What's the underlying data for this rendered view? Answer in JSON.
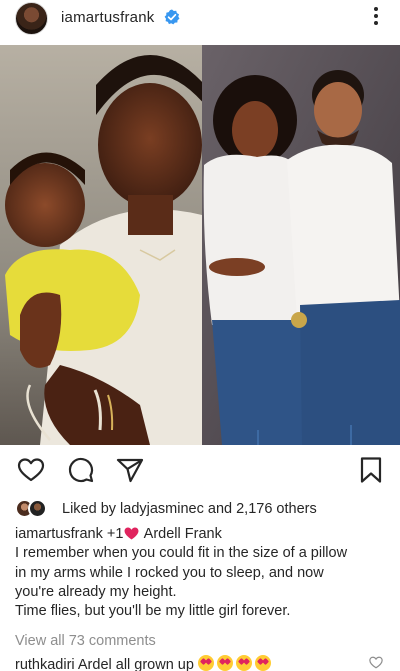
{
  "header": {
    "username": "iamartusfrank",
    "verified": true,
    "avatar_icon": "profile-avatar",
    "more_icon": "more-vertical-icon"
  },
  "post": {
    "left_panel": "child-held-by-father-photo",
    "right_panel": "father-and-daughter-photo"
  },
  "actions": {
    "like_icon": "heart-icon",
    "comment_icon": "comment-icon",
    "share_icon": "send-icon",
    "save_icon": "bookmark-icon"
  },
  "likes": {
    "text": "Liked by ladyjasminec and 2,176 others"
  },
  "caption": {
    "username": "iamartusfrank",
    "mention_prefix": "+1",
    "mention_name": "Ardell Frank",
    "heart_color": "#e0245e",
    "lines": [
      "I remember when you could fit in the size of a pillow",
      "in my arms while I rocked you to sleep, and now",
      "you're already my height.",
      "Time flies, but you'll be my little girl forever."
    ]
  },
  "view_all": "View all 73 comments",
  "comment": {
    "username": "ruthkadiri",
    "text": "Ardel all grown up",
    "emoji_count": 4,
    "like_icon": "heart-icon"
  },
  "colors": {
    "text": "#262626",
    "muted": "#8e8e8e",
    "verified": "#3897f0"
  }
}
